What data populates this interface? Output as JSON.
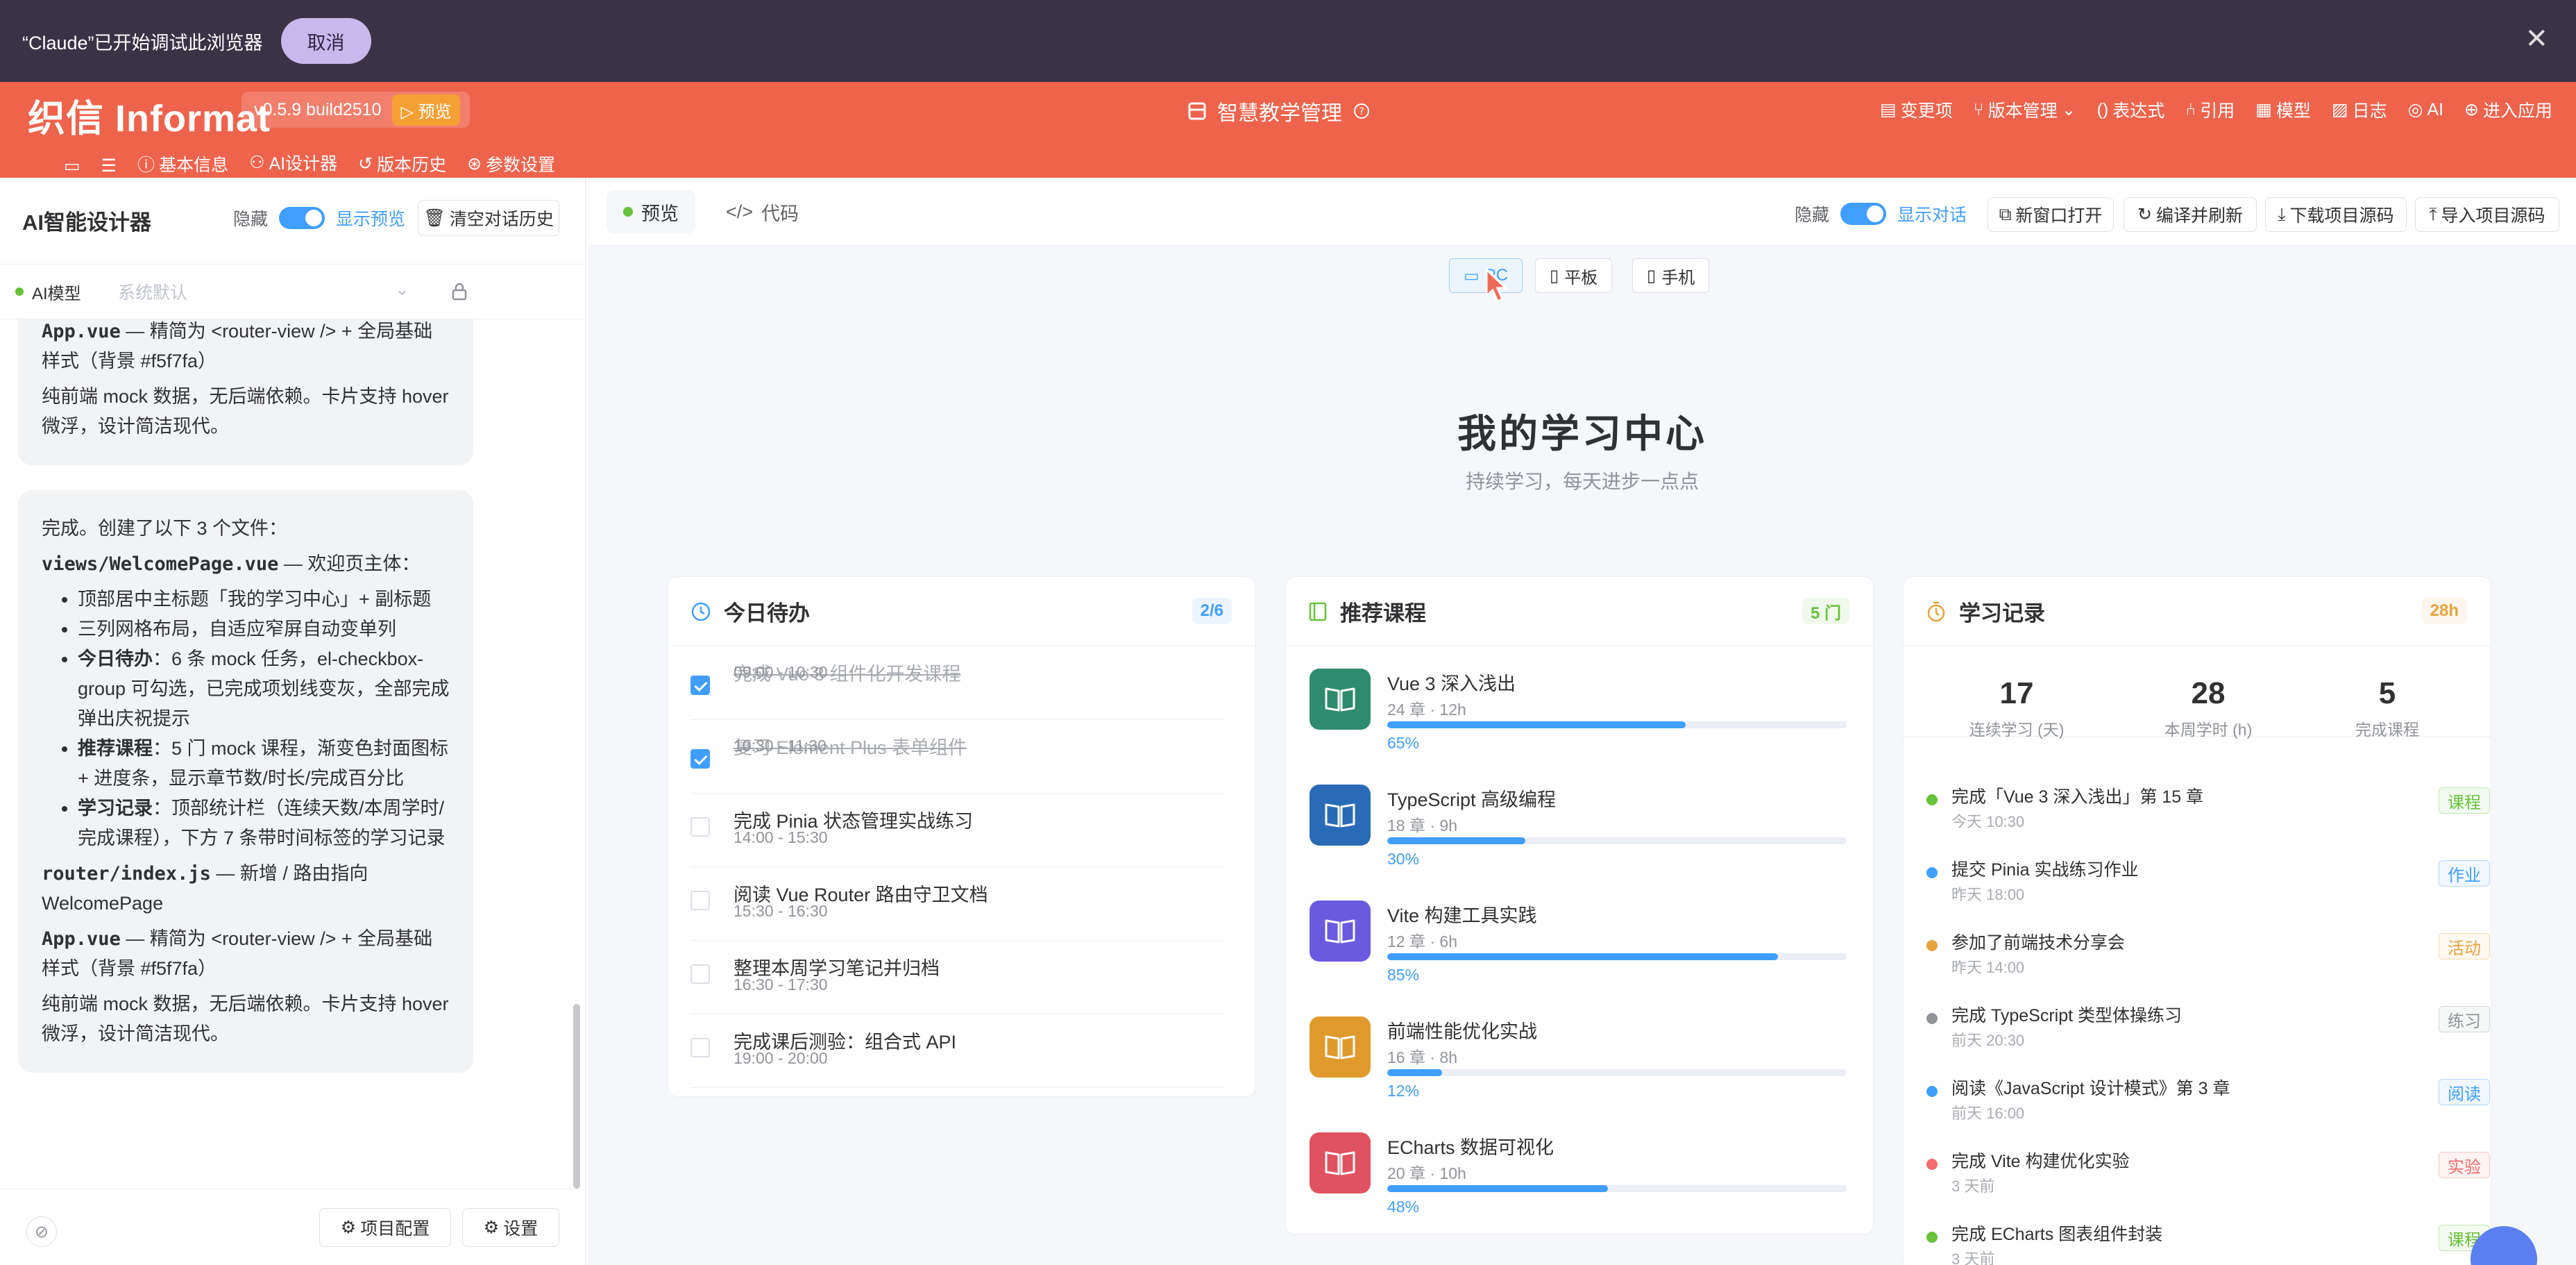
{
  "banner": {
    "message": "“Claude”已开始调试此浏览器",
    "cancel": "取消",
    "close": "✕"
  },
  "app": {
    "logo": "织信 Informat",
    "version": "v0.5.9 build2510",
    "preview": "▷ 预览",
    "title": "智慧教学管理",
    "menu": [
      "变更项",
      "版本管理",
      "表达式",
      "引用",
      "模型",
      "日志",
      "AI",
      "进入应用"
    ],
    "subnav": [
      "基本信息",
      "AI设计器",
      "版本历史",
      "参数设置"
    ]
  },
  "left": {
    "title": "AI智能设计器",
    "hide": "隐藏",
    "show_preview": "显示预览",
    "clear": "清空对话历史",
    "model_label": "AI模型",
    "model_placeholder": "系统默认",
    "msg1_app_code": "App.vue",
    "msg1_app_text": " — 精简为 <router-view /> + 全局基础样式（背景 #f5f7fa）",
    "msg1_mock": "纯前端 mock 数据，无后端依赖。卡片支持 hover 微浮，设计简洁现代。",
    "msg2_intro": "完成。创建了以下 3 个文件：",
    "msg2_file1_code": "views/WelcomePage.vue",
    "msg2_file1_text": " — 欢迎页主体：",
    "bullet1": "顶部居中主标题「我的学习中心」+ 副标题",
    "bullet2": "三列网格布局，自适应窄屏自动变单列",
    "bullet3_b": "今日待办",
    "bullet3": "：6 条 mock 任务，el-checkbox-group 可勾选，已完成项划线变灰，全部完成弹出庆祝提示",
    "bullet4_b": "推荐课程",
    "bullet4": "：5 门 mock 课程，渐变色封面图标 + 进度条，显示章节数/时长/完成百分比",
    "bullet5_b": "学习记录",
    "bullet5": "：顶部统计栏（连续天数/本周学时/完成课程），下方 7 条带时间标签的学习记录",
    "msg2_router_code": "router/index.js",
    "msg2_router_text": " — 新增 / 路由指向 WelcomePage",
    "msg2_app_code": "App.vue",
    "msg2_app_text": " — 精简为 <router-view /> + 全局基础样式（背景 #f5f7fa）",
    "msg2_mock": "纯前端 mock 数据，无后端依赖。卡片支持 hover 微浮，设计简洁现代。",
    "project_config": "项目配置",
    "settings": "设置"
  },
  "right": {
    "tab_preview": "预览",
    "tab_code": "代码",
    "hide": "隐藏",
    "show_chat": "显示对话",
    "open_new": "新窗口打开",
    "compile": "编译并刷新",
    "download": "下载项目源码",
    "import": "导入项目源码",
    "devices": [
      "PC",
      "平板",
      "手机"
    ]
  },
  "page": {
    "title": "我的学习中心",
    "subtitle": "持续学习，每天进步一点点",
    "todo": {
      "title": "今日待办",
      "badge": "2/6",
      "items": [
        {
          "text": "完成 Vue 3 组件化开发课程",
          "time": "09:00 - 10:30",
          "done": true
        },
        {
          "text": "复习 Element Plus 表单组件",
          "time": "10:30 - 11:30",
          "done": true
        },
        {
          "text": "完成 Pinia 状态管理实战练习",
          "time": "14:00 - 15:30",
          "done": false
        },
        {
          "text": "阅读 Vue Router 路由守卫文档",
          "time": "15:30 - 16:30",
          "done": false
        },
        {
          "text": "整理本周学习笔记并归档",
          "time": "16:30 - 17:30",
          "done": false
        },
        {
          "text": "完成课后测验：组合式 API",
          "time": "19:00 - 20:00",
          "done": false
        }
      ]
    },
    "courses": {
      "title": "推荐课程",
      "badge": "5 门",
      "items": [
        {
          "title": "Vue 3 深入浅出",
          "meta": "24 章 · 12h",
          "progress": 65,
          "pct": "65%",
          "color": "#2e8b6e"
        },
        {
          "title": "TypeScript 高级编程",
          "meta": "18 章 · 9h",
          "progress": 30,
          "pct": "30%",
          "color": "#2a6bb8"
        },
        {
          "title": "Vite 构建工具实践",
          "meta": "12 章 · 6h",
          "progress": 85,
          "pct": "85%",
          "color": "#6a5ae0"
        },
        {
          "title": "前端性能优化实战",
          "meta": "16 章 · 8h",
          "progress": 12,
          "pct": "12%",
          "color": "#e09a2c"
        },
        {
          "title": "ECharts 数据可视化",
          "meta": "20 章 · 10h",
          "progress": 48,
          "pct": "48%",
          "color": "#e05260"
        }
      ]
    },
    "records": {
      "title": "学习记录",
      "badge": "28h",
      "stats": [
        {
          "n": "17",
          "l": "连续学习 (天)"
        },
        {
          "n": "28",
          "l": "本周学时 (h)"
        },
        {
          "n": "5",
          "l": "完成课程"
        }
      ],
      "items": [
        {
          "text": "完成「Vue 3 深入浅出」第 15 章",
          "time": "今天 10:30",
          "tag": "课程",
          "color": "#67c23a"
        },
        {
          "text": "提交 Pinia 实战练习作业",
          "time": "昨天 18:00",
          "tag": "作业",
          "color": "#409eff"
        },
        {
          "text": "参加了前端技术分享会",
          "time": "昨天 14:00",
          "tag": "活动",
          "color": "#e6a23c"
        },
        {
          "text": "完成 TypeScript 类型体操练习",
          "time": "前天 20:30",
          "tag": "练习",
          "color": "#909399"
        },
        {
          "text": "阅读《JavaScript 设计模式》第 3 章",
          "time": "前天 16:00",
          "tag": "阅读",
          "color": "#409eff"
        },
        {
          "text": "完成 Vite 构建优化实验",
          "time": "3 天前",
          "tag": "实验",
          "color": "#f56c6c"
        },
        {
          "text": "完成 ECharts 图表组件封装",
          "time": "3 天前",
          "tag": "课程",
          "color": "#67c23a"
        }
      ]
    }
  }
}
